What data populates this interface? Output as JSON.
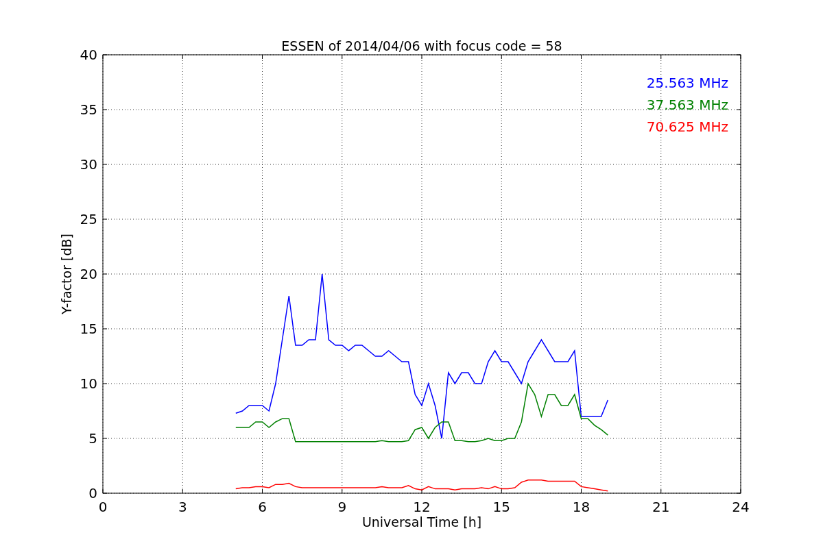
{
  "figure": {
    "chart_data": {
      "type": "line",
      "title": "ESSEN of 2014/04/06 with focus code = 58",
      "xlabel": "Universal Time [h]",
      "ylabel": "Y-factor [dB]",
      "x": [
        5,
        5.25,
        5.5,
        5.75,
        6,
        6.25,
        6.5,
        6.75,
        7,
        7.25,
        7.5,
        7.75,
        8,
        8.25,
        8.5,
        8.75,
        9,
        9.25,
        9.5,
        9.75,
        10,
        10.25,
        10.5,
        10.75,
        11,
        11.25,
        11.5,
        11.75,
        12,
        12.25,
        12.5,
        12.75,
        13,
        13.25,
        13.5,
        13.75,
        14,
        14.25,
        14.5,
        14.75,
        15,
        15.25,
        15.5,
        15.75,
        16,
        16.25,
        16.5,
        16.75,
        17,
        17.25,
        17.5,
        17.75,
        18,
        18.25,
        18.5,
        18.75,
        19
      ],
      "series": [
        {
          "name": "25.563 MHz",
          "color": "#0000ff",
          "values": [
            7.3,
            7.5,
            8,
            8,
            8,
            7.5,
            10,
            14,
            18,
            13.5,
            13.5,
            14,
            14,
            20,
            14,
            13.5,
            13.5,
            13,
            13.5,
            13.5,
            13,
            12.5,
            12.5,
            13,
            12.5,
            12,
            12,
            9,
            8,
            10,
            8,
            5,
            11,
            10,
            11,
            11,
            10,
            10,
            12,
            13,
            12,
            12,
            11,
            10,
            12,
            13,
            14,
            13,
            12,
            12,
            12,
            13,
            7,
            7,
            7,
            7,
            8.5
          ]
        },
        {
          "name": "37.563 MHz",
          "color": "#008000",
          "values": [
            6,
            6,
            6,
            6.5,
            6.5,
            6,
            6.5,
            6.8,
            6.8,
            4.7,
            4.7,
            4.7,
            4.7,
            4.7,
            4.7,
            4.7,
            4.7,
            4.7,
            4.7,
            4.7,
            4.7,
            4.7,
            4.8,
            4.7,
            4.7,
            4.7,
            4.8,
            5.8,
            6,
            5,
            6,
            6.5,
            6.5,
            4.8,
            4.8,
            4.7,
            4.7,
            4.8,
            5,
            4.8,
            4.8,
            5,
            5,
            6.5,
            10,
            9,
            7,
            9,
            9,
            8,
            8,
            9,
            6.8,
            6.8,
            6.2,
            5.8,
            5.3
          ]
        },
        {
          "name": "70.625 MHz",
          "color": "#ff0000",
          "values": [
            0.4,
            0.5,
            0.5,
            0.6,
            0.6,
            0.5,
            0.8,
            0.8,
            0.9,
            0.6,
            0.5,
            0.5,
            0.5,
            0.5,
            0.5,
            0.5,
            0.5,
            0.5,
            0.5,
            0.5,
            0.5,
            0.5,
            0.6,
            0.5,
            0.5,
            0.5,
            0.7,
            0.4,
            0.3,
            0.6,
            0.4,
            0.4,
            0.4,
            0.3,
            0.4,
            0.4,
            0.4,
            0.5,
            0.4,
            0.6,
            0.4,
            0.4,
            0.5,
            1,
            1.2,
            1.2,
            1.2,
            1.1,
            1.1,
            1.1,
            1.1,
            1.1,
            0.6,
            0.5,
            0.4,
            0.3,
            0.2
          ]
        }
      ],
      "xlim": [
        0,
        24
      ],
      "ylim": [
        0,
        40
      ],
      "xticks": [
        0,
        3,
        6,
        9,
        12,
        15,
        18,
        21,
        24
      ],
      "yticks": [
        0,
        5,
        10,
        15,
        20,
        25,
        30,
        35,
        40
      ],
      "grid": true
    }
  }
}
